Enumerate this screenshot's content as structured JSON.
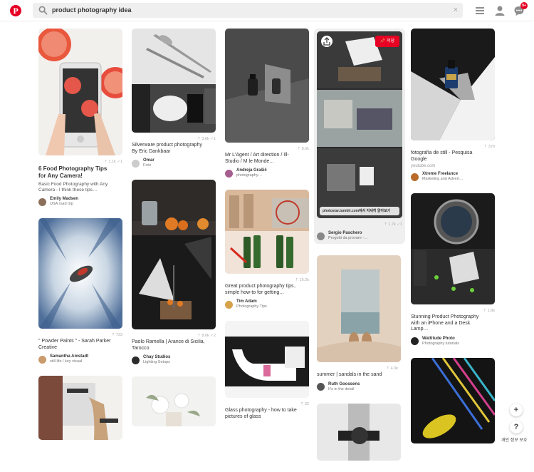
{
  "header": {
    "logo_letter": "P",
    "search_query": "product photography idea",
    "clear": "×",
    "notification_count": "9+"
  },
  "pins": {
    "p1": {
      "stats": "⇡ 1.1k ✓1",
      "title": "6 Food Photography Tips for Any Camera!",
      "desc": "Basic Food Photography with Any Camera - I think these tips…",
      "user": "Emily Madsen",
      "board": "USA road trip"
    },
    "p2": {
      "stats": "⇡ 723",
      "title": "\" Powder Paints \" - Sarah Parker Creative",
      "user": "Samantha Amstadt",
      "board": "still life / key visual"
    },
    "p4": {
      "stats": "⇡ 3.6k ✓1",
      "title": "Silverware product photography By Eric Dankbaar",
      "user": "Omar",
      "board": "Foto"
    },
    "p5": {
      "stats": "⇡ 8.6k ✓2",
      "title": "Paolo Ramella | Arance di Sicilia, Tarocco",
      "user": "Chay Studios",
      "board": "Lighting Setups"
    },
    "p7": {
      "stats": "⇡ 8.6k",
      "title": "Mr L'Agent / Art direction / Ill-Studio / M le Monde…",
      "user": "Andreja Grašič",
      "board": "photography…"
    },
    "p8": {
      "stats": "⇡ 16.2k",
      "title": "Great product photography tips.. simple how-to for getting…",
      "user": "Tim Adam",
      "board": "Photography Tips"
    },
    "p9": {
      "stats": "⇡ 32",
      "title": "Glass photography - how to take pictures of glass"
    },
    "p10": {
      "stats": "⇡ 1.7k ✓1",
      "watermark": "photostar.tumblr.com에서 자세히 알아보기",
      "save": "저장",
      "user": "Sergio Paschero",
      "board": "Progetti da provare -…"
    },
    "p11": {
      "stats": "⇡ 4.3k",
      "title": "summer | sandals in the sand",
      "user": "Ruth Goossens",
      "board": "It's in the detail"
    },
    "p13": {
      "stats": "⇡ 379",
      "title": "fotografía de still - Pesquisa Google",
      "source": "youtube.com",
      "user": "Xtreme Freelance",
      "board": "Marketing and Advert…"
    },
    "p14": {
      "stats": "⇡ 1.8k",
      "title": "Stunning Product Photography with an iPhone and a Desk Lamp…",
      "user": "Wattitude Photo",
      "board": "Photography tutorials"
    }
  },
  "floating": {
    "add": "+",
    "help": "?",
    "privacy": "개인 정보 보호"
  }
}
